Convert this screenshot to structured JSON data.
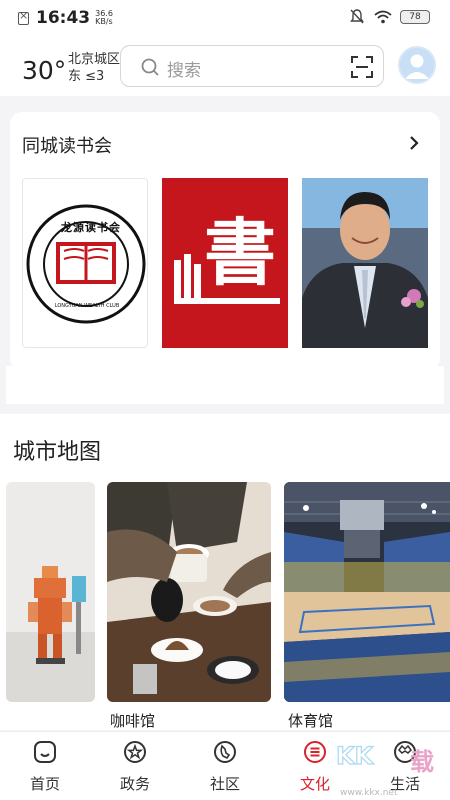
{
  "status_bar": {
    "time": "16:43",
    "net_speed_value": "36.6",
    "net_speed_unit": "KB/s",
    "battery": "78"
  },
  "header": {
    "temperature": "30°",
    "location": "北京城区",
    "wind": "东 ≤3",
    "search_placeholder": "搜索"
  },
  "reading_club": {
    "title": "同城读书会",
    "items": [
      {
        "logo_text": "龙源读书会",
        "logo_subtext": "LONGYUAN WEALTH CLUB"
      },
      {
        "logo_text": "書"
      },
      {
        "photo": "portrait"
      }
    ]
  },
  "city_map": {
    "title": "城市地图",
    "places": [
      {
        "label": ""
      },
      {
        "label": "咖啡馆"
      },
      {
        "label": "体育馆"
      }
    ]
  },
  "bottom_nav": {
    "items": [
      {
        "label": "首页",
        "icon": "home-icon"
      },
      {
        "label": "政务",
        "icon": "government-icon"
      },
      {
        "label": "社区",
        "icon": "community-icon"
      },
      {
        "label": "文化",
        "icon": "culture-icon",
        "active": true
      },
      {
        "label": "生活",
        "icon": "life-icon"
      }
    ],
    "active_color": "#d8232a"
  },
  "watermark": {
    "letters": "KK",
    "suffix": "载",
    "url": "www.kkx.net"
  }
}
